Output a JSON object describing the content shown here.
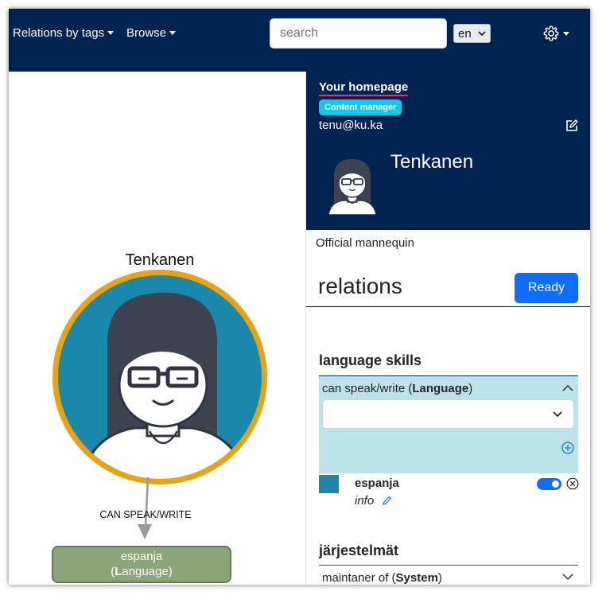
{
  "navbar": {
    "menu1": "Relations by tags",
    "menu2": "Browse",
    "search_placeholder": "search",
    "language": "en"
  },
  "graph": {
    "node_name": "Tenkanen",
    "edge_label": "CAN SPEAK/WRITE",
    "target_name": "espanja",
    "target_type_open": "(",
    "target_type_bold": "L",
    "target_type_rest": "anguage)",
    "ring_color": "#e8a313",
    "node_bg": "#1a88aa",
    "target_bg": "#8aa677"
  },
  "profile": {
    "homepage_link": "Your homepage",
    "badge": "Content manager",
    "email": "tenu@ku.ka",
    "name": "Tenkanen",
    "description": "Official mannequin"
  },
  "relations": {
    "title": "relations",
    "ready_button": "Ready",
    "language_section": {
      "title": "language skills",
      "relation_prefix": "can speak/write (",
      "relation_type": "Language",
      "relation_suffix": ")",
      "entries": [
        {
          "name": "espanja",
          "info": "info",
          "enabled": true
        }
      ]
    },
    "system_section": {
      "title": "järjestelmät",
      "relation_prefix": "maintaner of (",
      "relation_type": "System",
      "relation_suffix": ")"
    }
  },
  "colors": {
    "navy": "#002352",
    "primary": "#0d6efd",
    "info": "#0dcaf0",
    "skill_bg": "#bde3ea"
  }
}
